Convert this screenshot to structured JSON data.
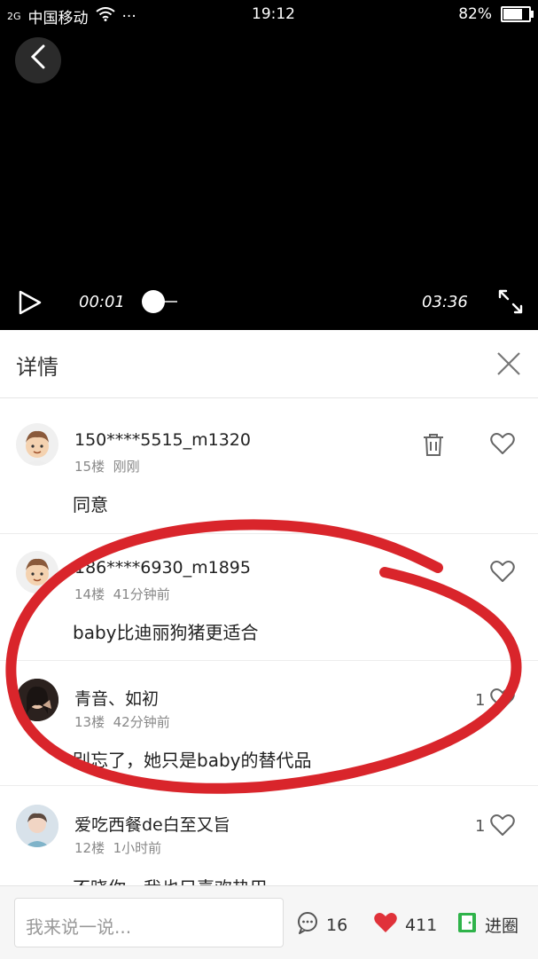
{
  "status_bar": {
    "network": "2G",
    "carrier": "中国移动",
    "more": "···",
    "time": "19:12",
    "battery": "82%",
    "battery_level": 0.82
  },
  "player": {
    "current_time": "00:01",
    "duration": "03:36"
  },
  "details": {
    "title": "详情"
  },
  "comments": [
    {
      "username": "150****5515_m1320",
      "floor": "15楼",
      "time": "刚刚",
      "text": "同意",
      "likes": ""
    },
    {
      "username": "186****6930_m1895",
      "floor": "14楼",
      "time": "41分钟前",
      "text": "baby比迪丽狗猪更适合",
      "likes": ""
    },
    {
      "username": "青音、如初",
      "floor": "13楼",
      "time": "42分钟前",
      "text": "别忘了，她只是baby的替代品",
      "likes": "1"
    },
    {
      "username": "爱吃西餐de白至又旨",
      "floor": "12楼",
      "time": "1小时前",
      "text": "不晓你，我也只喜欢热巴",
      "likes": "1"
    }
  ],
  "footer": {
    "input_placeholder": "我来说一说...",
    "comment_count": "16",
    "like_count": "411",
    "enter_circle": "进圈"
  },
  "colors": {
    "accent_red": "#e0323a",
    "annotation_red": "#d9252b",
    "enter_green": "#2fb34a"
  }
}
